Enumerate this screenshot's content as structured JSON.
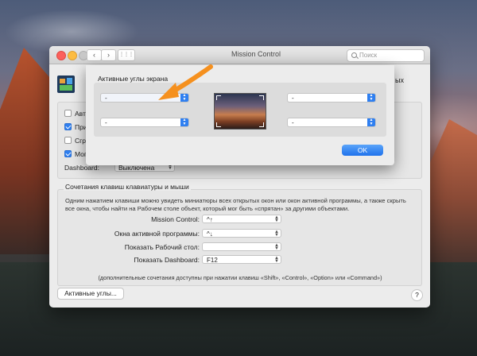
{
  "window": {
    "title": "Mission Control",
    "search_placeholder": "Поиск",
    "nav_back": "‹",
    "nav_forward": "›",
    "grid_icon": "⋮⋮⋮",
    "clipped_right": "ых"
  },
  "options": [
    {
      "label": "Авт",
      "checked": false
    },
    {
      "label": "При",
      "checked": true
    },
    {
      "label": "Сгр",
      "checked": false
    },
    {
      "label": "Мог",
      "checked": true
    }
  ],
  "dashboard": {
    "label": "Dashboard:",
    "value": "Выключена"
  },
  "keyboard": {
    "heading": "Сочетания клавиш клавиатуры и мыши",
    "description": "Одним нажатием клавиши можно увидеть миниатюры всех открытых окон или окон активной программы, а также скрыть все окна, чтобы найти на Рабочем столе объект, который мог быть «спрятан» за другими объектами.",
    "rows": [
      {
        "label": "Mission Control:",
        "value": "^↑"
      },
      {
        "label": "Окна активной программы:",
        "value": "^↓"
      },
      {
        "label": "Показать Рабочий стол:",
        "value": ""
      },
      {
        "label": "Показать Dashboard:",
        "value": "F12"
      }
    ],
    "note": "(дополнительные сочетания доступны при нажатии клавиш «Shift», «Control», «Option» или «Command»)"
  },
  "hot_corners_button": "Активные углы...",
  "help_button": "?",
  "sheet": {
    "title": "Активные углы экрана",
    "top_left": "-",
    "bottom_left": "-",
    "top_right": "-",
    "bottom_right": "-",
    "ok": "OK"
  },
  "colors": {
    "accent": "#2f7ff0",
    "arrow": "#f5901e"
  }
}
